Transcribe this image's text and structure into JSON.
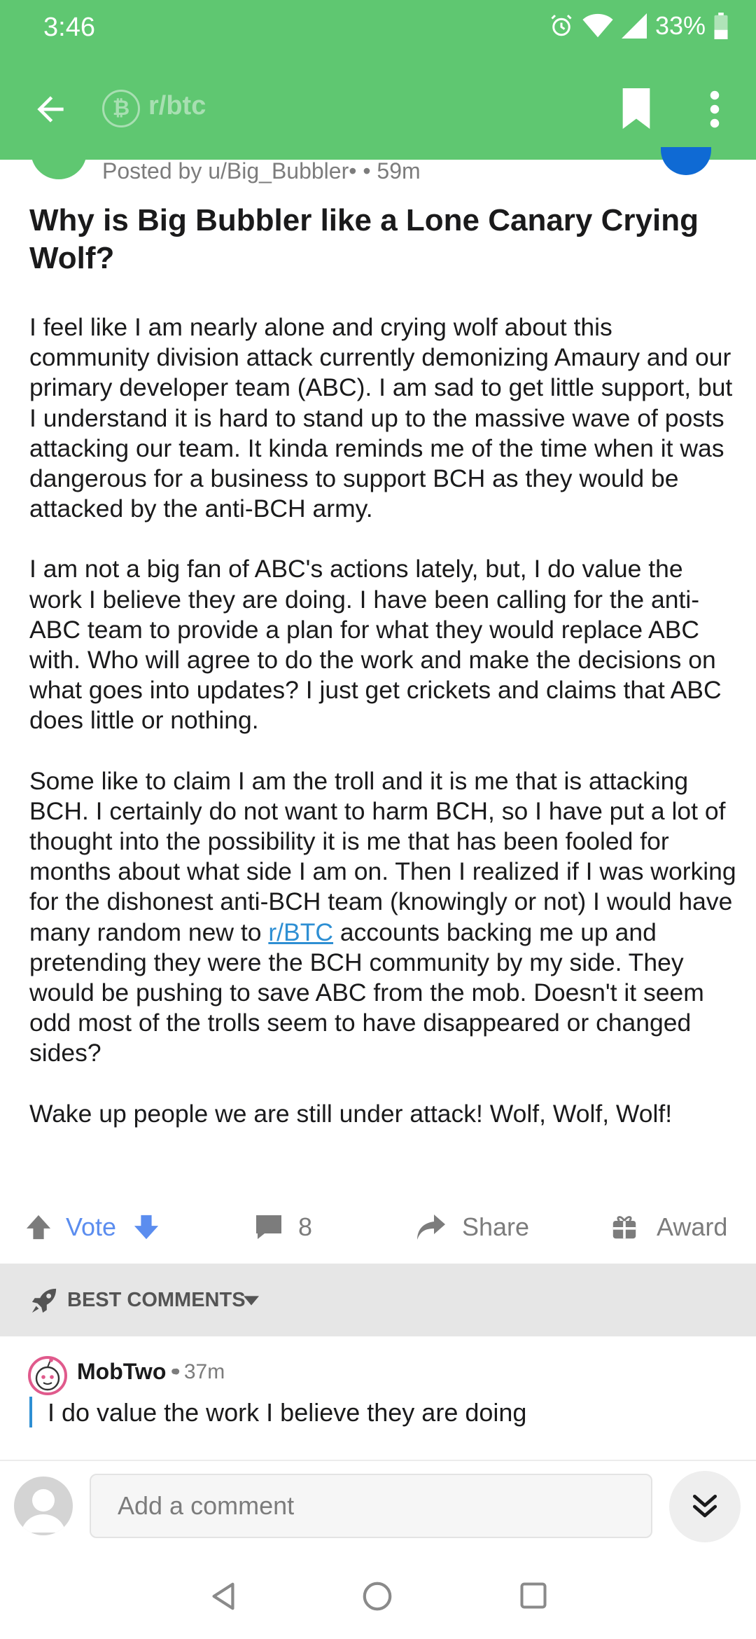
{
  "status_bar": {
    "time": "3:46",
    "battery": "33%",
    "icons": [
      "alarm-icon",
      "wifi-icon",
      "signal-icon",
      "battery-icon"
    ]
  },
  "toolbar": {
    "subreddit": "r/btc",
    "icons": [
      "back-arrow-icon",
      "bitcoin-icon",
      "bookmark-icon",
      "more-vertical-icon"
    ]
  },
  "post": {
    "author": "Posted by u/Big_Bubbler",
    "author_dot": "•",
    "age": "• 59m",
    "title": "Why is Big Bubbler like a Lone Canary Crying Wolf?",
    "body": {
      "p1": "I feel like I am nearly alone and crying wolf about this community division attack currently demonizing Amaury and our primary developer team (ABC). I am sad to get little support, but I understand it is hard to stand up to the massive wave of posts attacking our team. It kinda reminds me of the time when it was dangerous for a business to support BCH as they would be attacked by the anti-BCH army.",
      "p2": "I am not a big fan of ABC's actions lately, but, I do value the work I believe they are doing. I have been calling for the anti-ABC team to provide a plan for what they would replace ABC with. Who will agree to do the work and make the decisions on what goes into updates? I just get crickets and claims that ABC does little or nothing.",
      "p3_before": "Some like to claim I am the troll and it is me that is attacking BCH. I certainly do not want to harm BCH, so I have put a lot of thought into the possibility it is me that has been fooled for months about what side I am on. Then I realized if I was working for the dishonest anti-BCH team (knowingly or not) I would have many random new to ",
      "p3_link": "r/BTC",
      "p3_after": " accounts backing me up and pretending they were the BCH community by my side. They would be pushing to save ABC from the mob. Doesn't it seem odd most of the trolls seem to have disappeared or changed sides?",
      "p4": "Wake up people we are still under attack! Wolf, Wolf, Wolf!"
    }
  },
  "actions": {
    "vote_label": "Vote",
    "comment_count": "8",
    "share_label": "Share",
    "award_label": "Award",
    "colors": {
      "vote": "#5b8def",
      "muted": "#7c7c7c"
    }
  },
  "sort": {
    "label": "BEST COMMENTS"
  },
  "comment": {
    "author": "MobTwo",
    "author_dot": "•",
    "age": "• 37m",
    "quote": "I do value the work I believe they are doing"
  },
  "composer": {
    "placeholder": "Add a comment"
  },
  "theme": {
    "header_green": "#5fc771",
    "link_blue": "#2e8fd3"
  }
}
